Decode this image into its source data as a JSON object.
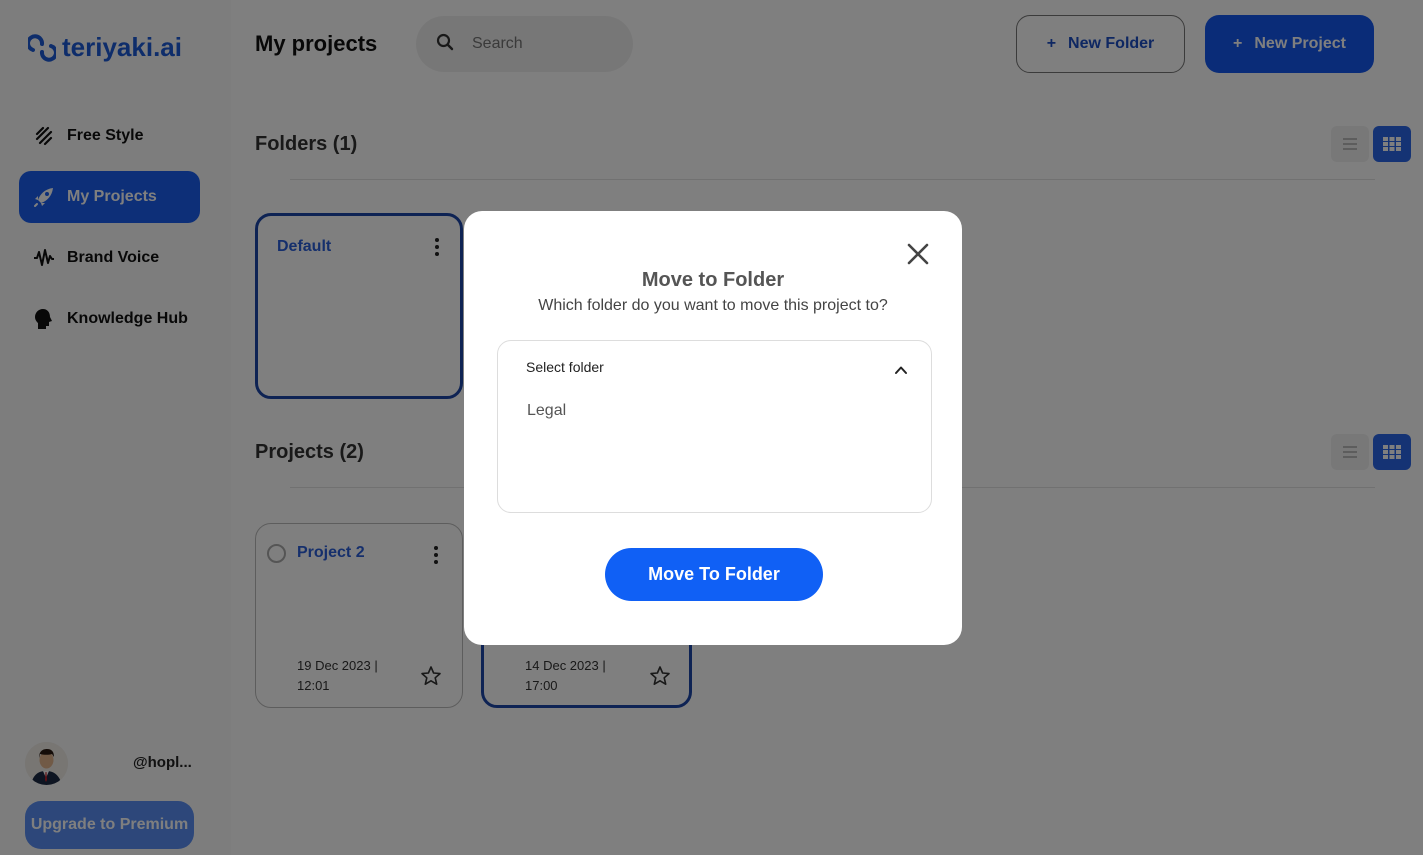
{
  "brand": {
    "name": "teriyaki.ai",
    "color": "#1d5bd6"
  },
  "sidebar": {
    "items": [
      {
        "label": "Free Style",
        "icon": "brush-strokes-icon"
      },
      {
        "label": "My Projects",
        "icon": "rocket-icon",
        "active": true
      },
      {
        "label": "Brand Voice",
        "icon": "soundwave-icon"
      },
      {
        "label": "Knowledge Hub",
        "icon": "head-icon"
      }
    ],
    "user_handle": "@hopl...",
    "upgrade_label": "Upgrade to Premium"
  },
  "header": {
    "title": "My projects",
    "search_placeholder": "Search",
    "new_folder_label": "New Folder",
    "new_project_label": "New Project",
    "plus": "+"
  },
  "folders": {
    "title": "Folders (1)",
    "items": [
      {
        "name": "Default"
      }
    ]
  },
  "projects": {
    "title": "Projects (2)",
    "items": [
      {
        "name": "Project 2",
        "date": "19 Dec 2023 |",
        "time": "12:01"
      },
      {
        "name": "",
        "date": "14 Dec 2023 |",
        "time": "17:00"
      }
    ]
  },
  "modal": {
    "title": "Move to Folder",
    "subtitle": "Which folder do you want to move this project to?",
    "select_label": "Select folder",
    "options": [
      "Legal"
    ],
    "submit_label": "Move To Folder"
  }
}
